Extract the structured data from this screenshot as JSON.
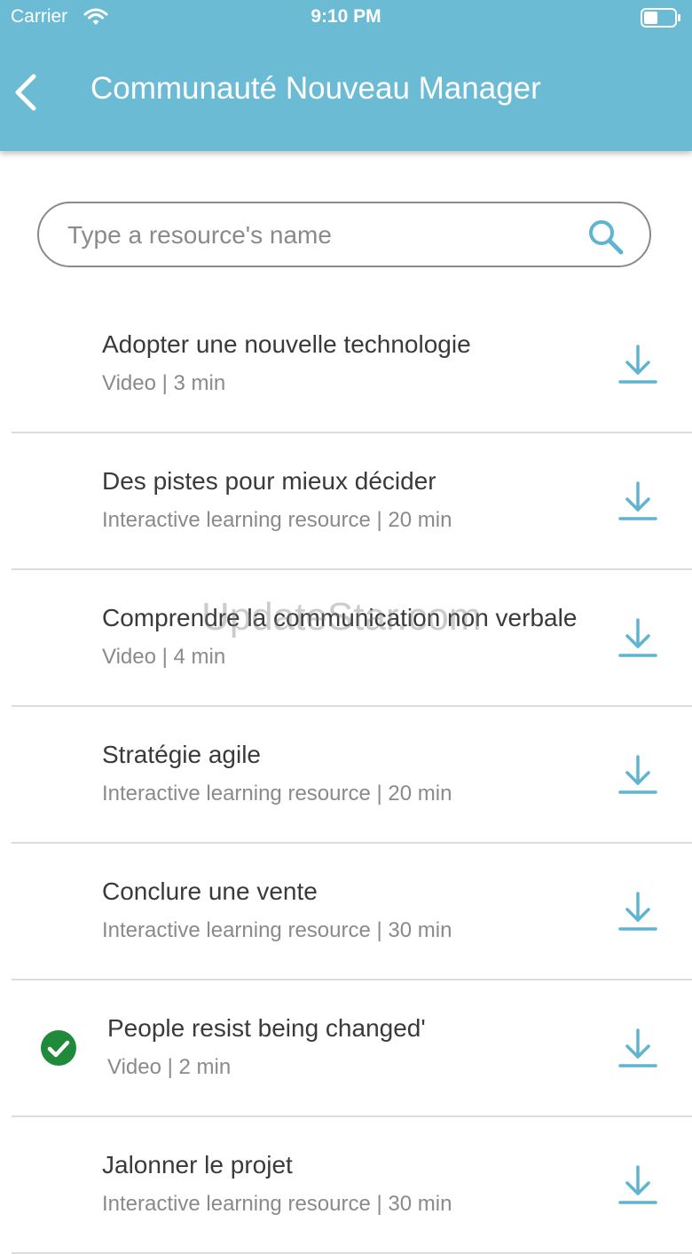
{
  "status_bar": {
    "carrier": "Carrier",
    "time": "9:10 PM"
  },
  "nav": {
    "title": "Communauté Nouveau Manager"
  },
  "search": {
    "placeholder": "Type a resource's name",
    "value": ""
  },
  "resources": [
    {
      "title": "Adopter une nouvelle technologie",
      "meta": "Video | 3 min",
      "completed": false
    },
    {
      "title": "Des pistes pour mieux décider",
      "meta": "Interactive learning resource | 20 min",
      "completed": false
    },
    {
      "title": "Comprendre la communication non verbale",
      "meta": "Video | 4 min",
      "completed": false
    },
    {
      "title": "Stratégie agile",
      "meta": "Interactive learning resource | 20 min",
      "completed": false
    },
    {
      "title": "Conclure une vente",
      "meta": "Interactive learning resource | 30 min",
      "completed": false
    },
    {
      "title": "People resist being changed'",
      "meta": "Video | 2 min",
      "completed": true
    },
    {
      "title": "Jalonner le projet",
      "meta": "Interactive learning resource | 30 min",
      "completed": false
    }
  ],
  "watermark": "UpdateStar.com",
  "colors": {
    "header": "#6bbbd5",
    "accent": "#5fb4d0",
    "check": "#1e8a3a"
  }
}
